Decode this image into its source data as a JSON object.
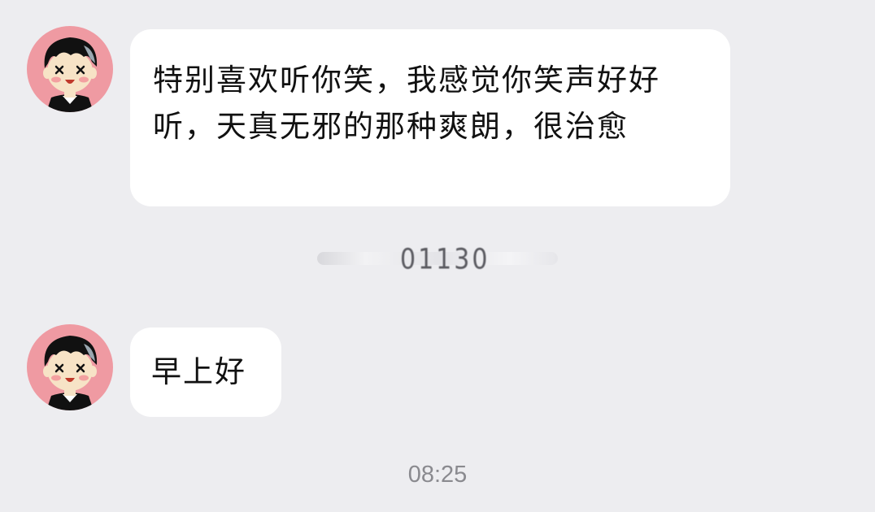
{
  "chat": {
    "messages": [
      {
        "sender": "other",
        "avatar_icon": "cartoon-boy-avatar-icon",
        "text": "特别喜欢听你笑，我感觉你笑声好好听，天真无邪的那种爽朗，很治愈"
      },
      {
        "sender": "other",
        "avatar_icon": "cartoon-boy-avatar-icon",
        "text": "早上好"
      }
    ],
    "recall_notice_text": "01130",
    "timestamp": "08:25"
  },
  "colors": {
    "background": "#ededf0",
    "bubble": "#ffffff",
    "avatar_bg": "#ef9aa2",
    "timestamp": "#8a8a8f"
  }
}
